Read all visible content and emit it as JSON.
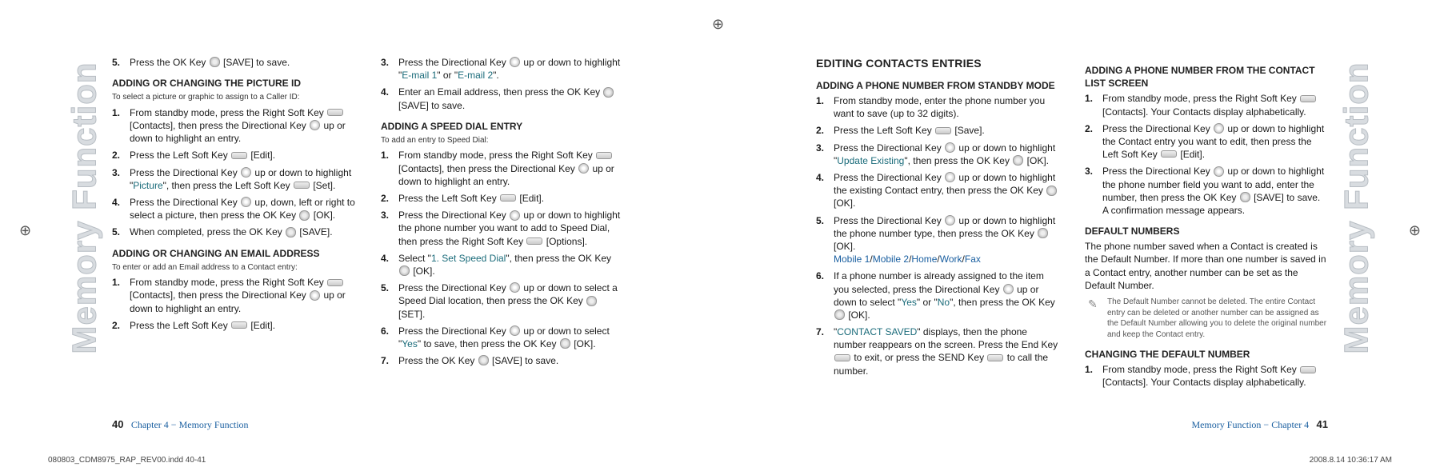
{
  "side_label": "Memory Function",
  "reg": "⊕",
  "footer": {
    "left_num": "40",
    "left_chap": "Chapter 4 − Memory Function",
    "right_chap": "Memory Function − Chapter 4",
    "right_num": "41"
  },
  "meta": {
    "left": "080803_CDM8975_RAP_REV00.indd   40-41",
    "right": "2008.8.14   10:36:17 AM"
  },
  "L": {
    "c1": {
      "i1": {
        "n": "5.",
        "t": "Press the OK Key ",
        " t2": " [SAVE] to save."
      },
      "h1": "ADDING OR CHANGING THE PICTURE ID",
      "sub1": "To select a picture or graphic to assign to a Caller ID:",
      "l1": [
        {
          "n": "1.",
          "a": "From standby mode, press the Right Soft Key ",
          "b": " [Contacts], then press the Directional Key ",
          "c": " up or down to highlight an entry."
        },
        {
          "n": "2.",
          "a": "Press the Left Soft Key ",
          "b": " [Edit]."
        },
        {
          "n": "3.",
          "a": "Press the Directional Key ",
          "b": " up or down to highlight \"",
          "hl": "Picture",
          "c": "\", then press the Left Soft Key ",
          "d": " [Set]."
        },
        {
          "n": "4.",
          "a": "Press the Directional Key ",
          "b": " up, down, left or right to select a picture, then press the OK Key ",
          "c": " [OK]."
        },
        {
          "n": "5.",
          "a": "When completed, press the OK Key ",
          "b": " [SAVE]."
        }
      ],
      "h2": "ADDING OR CHANGING AN EMAIL ADDRESS",
      "sub2": "To enter or add an Email address to a Contact entry:",
      "l2": [
        {
          "n": "1.",
          "a": "From standby mode, press the Right Soft Key ",
          "b": " [Contacts], then press the Directional Key ",
          "c": " up or down to highlight an entry."
        },
        {
          "n": "2.",
          "a": "Press the Left Soft Key ",
          "b": " [Edit]."
        }
      ]
    },
    "c2": {
      "l1": [
        {
          "n": "3.",
          "a": "Press the Directional Key ",
          "b": " up or down to highlight \"",
          "hl": "E-mail 1",
          "c": "\" or \"",
          "hl2": "E-mail 2",
          "d": "\"."
        },
        {
          "n": "4.",
          "a": "Enter an Email address, then press the OK Key ",
          "b": " [SAVE] to save."
        }
      ],
      "h1": "ADDING A SPEED DIAL ENTRY",
      "sub1": "To add an entry to Speed Dial:",
      "l2": [
        {
          "n": "1.",
          "a": "From standby mode, press the Right Soft Key ",
          "b": " [Contacts], then press the Directional Key ",
          "c": " up or down to highlight an entry."
        },
        {
          "n": "2.",
          "a": "Press the Left Soft Key ",
          "b": " [Edit]."
        },
        {
          "n": "3.",
          "a": "Press the Directional Key ",
          "b": " up or down to highlight the phone number you want to add to Speed Dial, then press the Right Soft Key ",
          "c": " [Options]."
        },
        {
          "n": "4.",
          "a": "Select \"",
          "hl": "1. Set Speed Dial",
          "b": "\", then press the OK Key ",
          "c": " [OK]."
        },
        {
          "n": "5.",
          "a": "Press the Directional Key ",
          "b": " up or down to select a Speed Dial location, then press the OK Key ",
          "c": " [SET]."
        },
        {
          "n": "6.",
          "a": "Press the Directional Key ",
          "b": " up or down to select \"",
          "hl": "Yes",
          "c": "\" to save, then press the OK Key ",
          "d": " [OK]."
        },
        {
          "n": "7.",
          "a": "Press the OK Key ",
          "b": " [SAVE] to save."
        }
      ]
    }
  },
  "R": {
    "c1": {
      "h1": "EDITING CONTACTS ENTRIES",
      "h2": "ADDING A PHONE NUMBER FROM STANDBY MODE",
      "l1": [
        {
          "n": "1.",
          "a": "From standby mode, enter the phone number you want to save (up to 32 digits)."
        },
        {
          "n": "2.",
          "a": "Press the Left Soft Key ",
          "b": " [Save]."
        },
        {
          "n": "3.",
          "a": "Press the Directional Key ",
          "b": " up or down to highlight \"",
          "hl": "Update Existing",
          "c": "\", then press the OK Key ",
          "d": " [OK]."
        },
        {
          "n": "4.",
          "a": "Press the Directional Key ",
          "b": " up or down to highlight the existing Contact entry, then press the OK Key ",
          "c": " [OK]."
        },
        {
          "n": "5.",
          "a": "Press the Directional Key ",
          "b": " up or down to highlight the phone number type, then press the OK Key ",
          "c": " [OK].",
          "opts": [
            "Mobile 1",
            "Mobile 2",
            "Home",
            "Work",
            "Fax"
          ]
        },
        {
          "n": "6.",
          "a": "If a phone number is already assigned to the item you selected, press the Directional Key ",
          "b": " up or down to select \"",
          "hl": "Yes",
          "c": "\" or \"",
          "hl2": "No",
          "d": "\", then press the OK Key ",
          "e": " [OK]."
        },
        {
          "n": "7.",
          "a": "\"",
          "hl": "CONTACT SAVED",
          "b": "\" displays, then the phone number reappears on the screen. Press the End Key ",
          "c": " to exit, or press the SEND Key ",
          "d": " to call the number."
        }
      ]
    },
    "c2": {
      "h1": "ADDING A PHONE NUMBER FROM THE CONTACT LIST SCREEN",
      "l1": [
        {
          "n": "1.",
          "a": "From standby mode, press the Right Soft Key ",
          "b": " [Contacts]. Your Contacts display alphabetically."
        },
        {
          "n": "2.",
          "a": "Press the Directional Key ",
          "b": " up or down to highlight the Contact entry you want to edit, then press the Left Soft Key ",
          "c": " [Edit]."
        },
        {
          "n": "3.",
          "a": "Press the Directional Key ",
          "b": " up or down to highlight the phone number field you want to add, enter the number, then press the OK Key ",
          "c": " [SAVE] to save. A confirmation message appears."
        }
      ],
      "h2": "DEFAULT NUMBERS",
      "p1": "The phone number saved when a Contact is created is the Default Number. If more than one number is saved in a Contact entry, another number can be set as the Default Number.",
      "note": "The Default Number cannot be deleted. The entire Contact entry can be deleted or another number can be assigned as the Default Number allowing you to delete the original number and keep the Contact entry.",
      "h3": "CHANGING THE DEFAULT NUMBER",
      "l2": [
        {
          "n": "1.",
          "a": "From standby mode, press the Right Soft Key ",
          "b": " [Contacts]. Your Contacts display alphabetically."
        }
      ]
    }
  }
}
